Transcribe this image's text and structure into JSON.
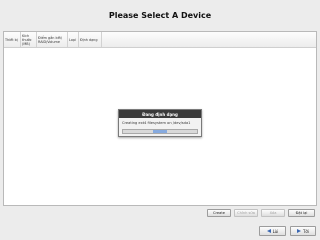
{
  "header": {
    "title": "Please Select A Device"
  },
  "table": {
    "columns": [
      "Thiết bị",
      "Kích thước (MB)",
      "Điểm gắn kết/ RAID/Volume",
      "Loại",
      "Định dạng"
    ]
  },
  "dialog": {
    "title": "Đang định dạng",
    "message": "Creating ext4 filesystem on /dev/sda1",
    "progress": 0.5
  },
  "actions": {
    "create": "Create",
    "edit": "Chỉnh sửa",
    "delete": "Xóa",
    "reset": "Đặt lại"
  },
  "nav": {
    "back": "Lùi",
    "next": "Tới"
  },
  "colors": {
    "dialog_title_bg": "#3a3a3a",
    "progress_fill": "#86aadf",
    "nav_arrow": "#3a67b2"
  }
}
